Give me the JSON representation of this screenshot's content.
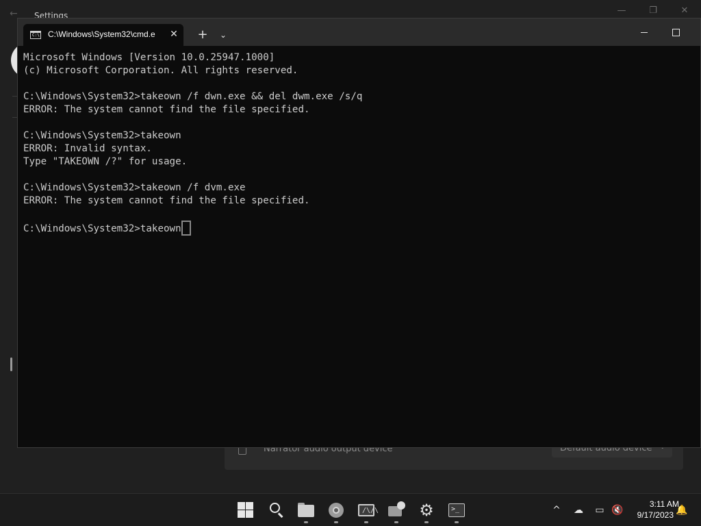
{
  "settings": {
    "title": "Settings",
    "row_label": "Narrator audio output device",
    "row_value": "Default audio device"
  },
  "terminal": {
    "tab_title": "C:\\Windows\\System32\\cmd.e",
    "close_glyph": "✕",
    "new_tab_glyph": "+",
    "dropdown_glyph": "⌄",
    "lines": [
      "Microsoft Windows [Version 10.0.25947.1000]",
      "(c) Microsoft Corporation. All rights reserved.",
      "",
      "C:\\Windows\\System32>takeown /f dwn.exe && del dwm.exe /s/q",
      "ERROR: The system cannot find the file specified.",
      "",
      "C:\\Windows\\System32>takeown",
      "ERROR: Invalid syntax.",
      "Type \"TAKEOWN /?\" for usage.",
      "",
      "C:\\Windows\\System32>takeown /f dvm.exe",
      "ERROR: The system cannot find the file specified.",
      "",
      "C:\\Windows\\System32>takeown"
    ],
    "text_color": "#cccccc",
    "background": "#0c0c0c"
  },
  "taskbar": {
    "apps": [
      {
        "name": "start-icon"
      },
      {
        "name": "search-icon"
      },
      {
        "name": "file-explorer-icon"
      },
      {
        "name": "chrome-icon"
      },
      {
        "name": "photos-icon"
      },
      {
        "name": "screen-cast-icon"
      },
      {
        "name": "settings-gear-icon"
      },
      {
        "name": "terminal-icon"
      }
    ],
    "tray": {
      "chevron": "^",
      "time": "3:11 AM",
      "date": "9/17/2023"
    }
  }
}
